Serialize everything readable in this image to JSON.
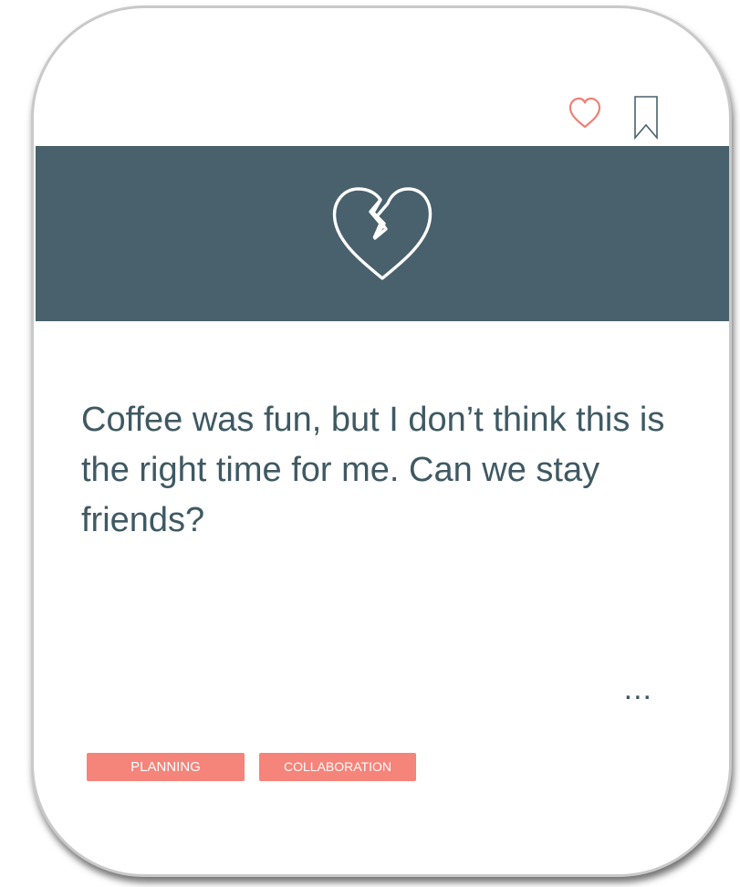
{
  "card": {
    "actions": {
      "like_icon": "heart-outline-icon",
      "bookmark_icon": "bookmark-outline-icon"
    },
    "banner": {
      "background_color": "#48616c",
      "icon": "broken-heart-icon"
    },
    "message": "Coffee was fun, but I don’t think this is the right time for me. Can we stay friends?",
    "more_label": "...",
    "tags": [
      {
        "label": "PLANNING"
      },
      {
        "label": "COLLABORATION"
      }
    ],
    "accent_color": "#f5847a",
    "text_color": "#3f5963"
  }
}
